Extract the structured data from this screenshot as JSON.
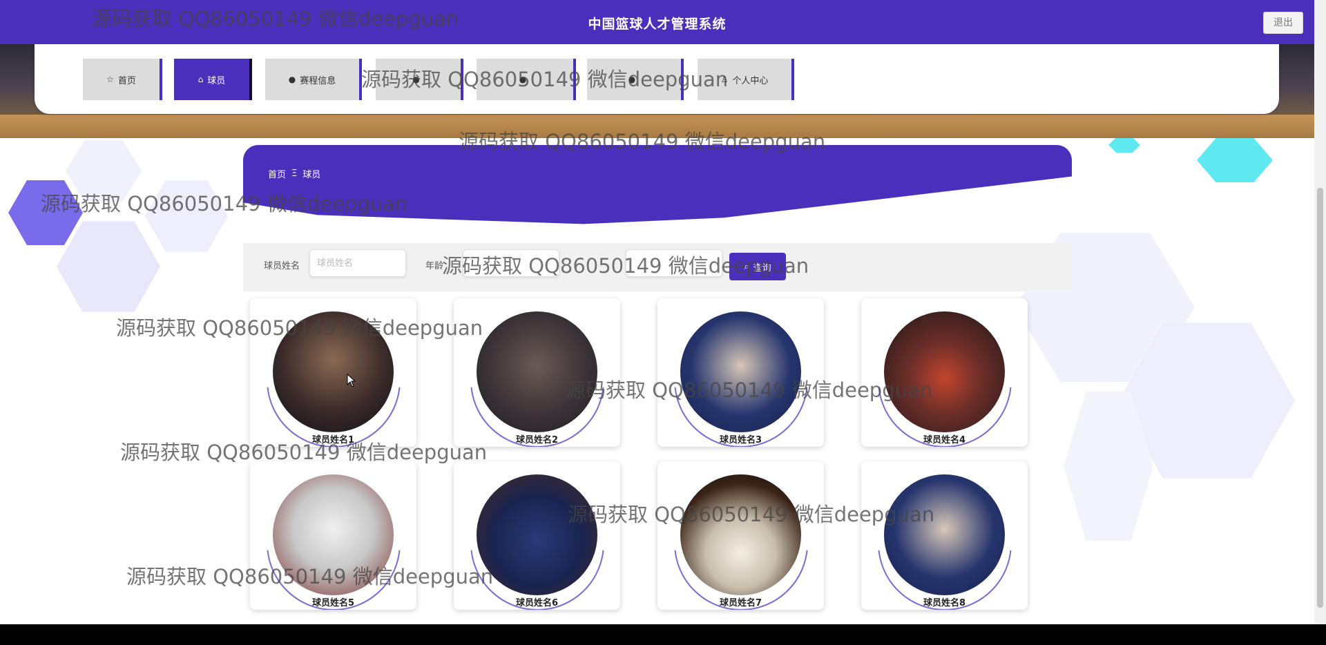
{
  "header": {
    "title": "中国篮球人才管理系统",
    "logout_label": "退出",
    "accent_color": "#4a2fbd"
  },
  "nav": {
    "items": [
      {
        "label": "首页",
        "icon": "star-icon",
        "active": false
      },
      {
        "label": "球员",
        "icon": "bag-icon",
        "active": true
      },
      {
        "label": "赛程信息",
        "icon": "info-icon",
        "active": false
      },
      {
        "label": "",
        "icon": "info-icon",
        "active": false
      },
      {
        "label": "",
        "icon": "info-icon",
        "active": false
      },
      {
        "label": "",
        "icon": "info-icon",
        "active": false
      },
      {
        "label": "个人中心",
        "icon": "user-icon",
        "active": false
      }
    ]
  },
  "breadcrumb": {
    "home": "首页",
    "separator": "Ξ",
    "current": "球员"
  },
  "search": {
    "field1_label": "球员姓名",
    "field1_placeholder": "球员姓名",
    "field2_label": "年龄",
    "field2_placeholder": "",
    "field3_label": "",
    "field3_placeholder": "",
    "button_label": "查询"
  },
  "players": [
    {
      "name": "球员姓名1"
    },
    {
      "name": "球员姓名2"
    },
    {
      "name": "球员姓名3"
    },
    {
      "name": "球员姓名4"
    },
    {
      "name": "球员姓名5"
    },
    {
      "name": "球员姓名6"
    },
    {
      "name": "球员姓名7"
    },
    {
      "name": "球员姓名8"
    }
  ],
  "watermark": "源码获取 QQ86050149 微信deepguan"
}
